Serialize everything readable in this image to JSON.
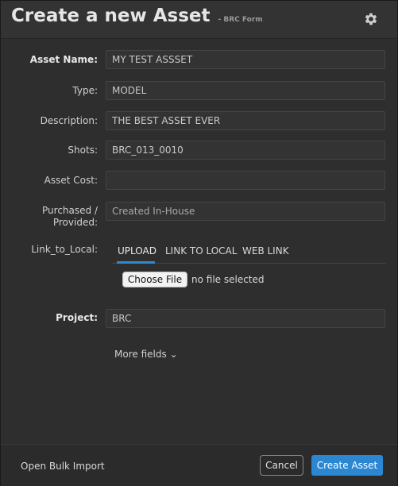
{
  "header": {
    "title": "Create a new Asset",
    "subtitle": "- BRC Form",
    "settings_icon": "gear-icon"
  },
  "form": {
    "asset_name": {
      "label": "Asset Name:",
      "value": "MY TEST ASSSET"
    },
    "type": {
      "label": "Type:",
      "value": "MODEL"
    },
    "description": {
      "label": "Description:",
      "value": "THE BEST ASSET EVER"
    },
    "shots": {
      "label": "Shots:",
      "value": "BRC_013_0010"
    },
    "asset_cost": {
      "label": "Asset Cost:",
      "value": ""
    },
    "purchased": {
      "label_line1": "Purchased /",
      "label_line2": "Provided:",
      "placeholder": "Created In-House"
    },
    "link_to_local": {
      "label": "Link_to_Local:",
      "tabs": [
        "UPLOAD",
        "LINK TO LOCAL",
        "WEB LINK"
      ],
      "active_tab": "UPLOAD",
      "choose_file_label": "Choose File",
      "file_status": "no file selected"
    },
    "project": {
      "label": "Project:",
      "value": "BRC"
    },
    "more_fields": "More fields ⌄"
  },
  "footer": {
    "bulk_import": "Open Bulk Import",
    "cancel": "Cancel",
    "create": "Create Asset"
  },
  "colors": {
    "accent": "#2b87d1",
    "background": "#2e2e2e"
  }
}
